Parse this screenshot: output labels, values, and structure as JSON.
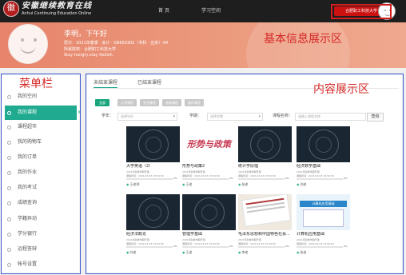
{
  "topbar": {
    "logo_seal": "徽",
    "logo_cn": "安徽继续教育在线",
    "logo_en": "Anhui Continuing Education Online",
    "nav": [
      "首 页",
      "学习空间"
    ],
    "school_button": "合肥职工科技大学"
  },
  "header": {
    "greeting": "李明，下午好",
    "major_line": "层次：2021年春季 · 会计 · G8650302（专科 · 业余）· 04",
    "school_line": "所属院校：合肥职工科技大学",
    "motto": "Stay hungry,stay foolish."
  },
  "annotations": {
    "basic_info": "基本信息展示区",
    "menu": "菜单栏",
    "content": "内容展示区"
  },
  "sidebar": {
    "items": [
      {
        "label": "我的空间",
        "active": false
      },
      {
        "label": "我的课程",
        "active": true
      },
      {
        "label": "课程超市",
        "active": false
      },
      {
        "label": "我的购物车",
        "active": false
      },
      {
        "label": "我的订单",
        "active": false
      },
      {
        "label": "我的作业",
        "active": false
      },
      {
        "label": "我的考试",
        "active": false
      },
      {
        "label": "成绩查询",
        "active": false
      },
      {
        "label": "学籍异动",
        "active": false
      },
      {
        "label": "学分银行",
        "active": false
      },
      {
        "label": "远程答辩",
        "active": false
      },
      {
        "label": "帐号设置",
        "active": false
      }
    ]
  },
  "content": {
    "tabs": [
      "未结束课程",
      "已结束课程"
    ],
    "filter_buttons": [
      {
        "label": "全部",
        "active": true
      },
      {
        "label": "公共课程",
        "active": false
      },
      {
        "label": "专业课程",
        "active": false
      },
      {
        "label": "选修课程",
        "active": false
      },
      {
        "label": "操作课程",
        "active": false
      }
    ],
    "filters": {
      "year_label": "学年：",
      "year_placeholder": "选择年份",
      "term_label": "学期：",
      "term_placeholder": "选择学期",
      "course_label": "课程名称：",
      "course_placeholder": "请输入课程名称",
      "query_button": "查询"
    },
    "courses": [
      {
        "title": "大学英语（2）",
        "sub": "2021年秋季学期开课",
        "date": "课程时间：2021/12/13 23:59:59",
        "progress": 0.0,
        "pct": "0%",
        "teacher": "王老师",
        "thumb": "circle"
      },
      {
        "title": "形势与政策2",
        "sub": "2021年秋季学期开课",
        "date": "课程时间：2021/12/13 23:59:59",
        "progress": 0.0,
        "pct": "0%",
        "teacher": "王老",
        "thumb": "calligraphy",
        "thumb_text": "形势与政策"
      },
      {
        "title": "统计学原理",
        "sub": "2021年秋季学期开课",
        "date": "课程时间：2021/12/13 23:59:59",
        "progress": 0.0,
        "pct": "0%",
        "teacher": "张老",
        "thumb": "circle"
      },
      {
        "title": "经济数学基础",
        "sub": "2021年秋季学期开课",
        "date": "课程时间：2021/12/13 23:59:59",
        "progress": 0.0,
        "pct": "0%",
        "teacher": "刘老",
        "thumb": "circle"
      },
      {
        "title": "经济法概论",
        "sub": "2021年秋季学期开课",
        "date": "课程时间：2021/12/13 23:59:59",
        "progress": 0.0,
        "pct": "0%",
        "teacher": "刘老",
        "thumb": "circle"
      },
      {
        "title": "管理学基础",
        "sub": "2021年秋季学期开课",
        "date": "课程时间：2021/12/13 23:59:59",
        "progress": 0.0,
        "pct": "0%",
        "teacher": "王老",
        "thumb": "circle"
      },
      {
        "title": "毛泽东思想和中国特色社会...",
        "sub": "2021年秋季学期开课",
        "date": "课程时间：2021/12/13 23:59:59",
        "progress": 0.0,
        "pct": "0%",
        "teacher": "李老",
        "thumb": "document"
      },
      {
        "title": "计算机应用基础",
        "sub": "2021年秋季学期开课",
        "date": "课程时间：2021/12/13 23:59:59",
        "progress": 0.0,
        "pct": "0%",
        "teacher": "张老",
        "thumb": "blue",
        "thumb_text": "计算机应用基础"
      }
    ]
  },
  "colors": {
    "topbar": "#1e1e1e",
    "accent": "#1aa67c",
    "header": "#e9906f",
    "annotation": "#d62828",
    "school_button": "#cc1111"
  }
}
